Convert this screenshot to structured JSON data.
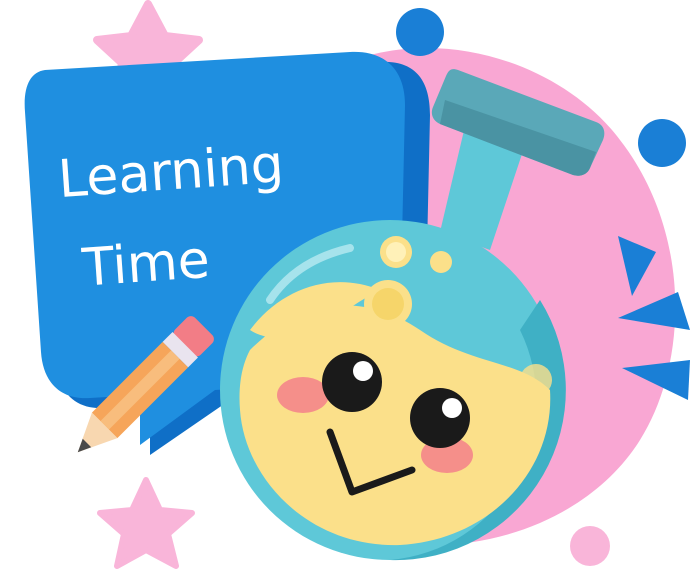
{
  "sign": {
    "line1": "Learning",
    "line2": "Time"
  },
  "colors": {
    "sign_blue": "#1f8fe0",
    "sign_blue_dark": "#0f6fc7",
    "pink_blob": "#f9a7d3",
    "flask_teal": "#5ec8d8",
    "flask_teal_dark": "#3fb0c5",
    "liquid_yellow": "#fbe08a",
    "cap_teal": "#5aa8b8",
    "blush": "#f47a8a",
    "pencil_orange": "#f6a55a",
    "eraser_pink": "#f27d86",
    "accent_blue": "#1a7fd6",
    "star_pink": "#f9b5d9"
  },
  "icons": [
    "star-icon",
    "pencil-icon",
    "flask-icon",
    "dot-icon",
    "sparkle-icon"
  ]
}
